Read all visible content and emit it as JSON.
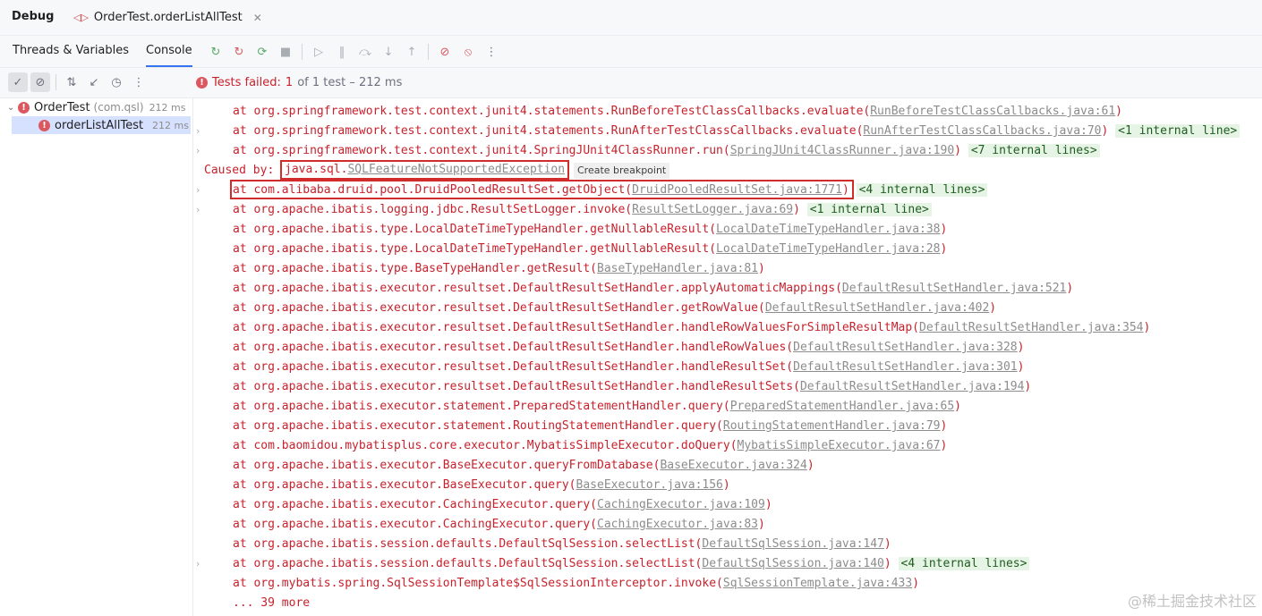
{
  "window": {
    "title": "Debug",
    "tab_label": "OrderTest.orderListAllTest"
  },
  "toolbar": {
    "tabs": [
      "Threads & Variables",
      "Console"
    ]
  },
  "status": {
    "failed_label": "Tests failed:",
    "failed_count": "1",
    "of_text": "of 1 test – 212 ms"
  },
  "tree": {
    "root": {
      "label": "OrderTest",
      "package": "(com.qsl)",
      "duration": "212 ms"
    },
    "child": {
      "label": "orderListAllTest",
      "duration": "212 ms"
    }
  },
  "console": {
    "caused_by": {
      "prefix": "Caused by:",
      "exception_pkg": "java.sql.",
      "exception_cls": "SQLFeatureNotSupportedException",
      "hint": "Create breakpoint"
    },
    "more": "... 39 more",
    "lines": [
      {
        "t": "at org.springframework.test.context.junit4.statements.RunBeforeTestClassCallbacks.evaluate(",
        "l": "RunBeforeTestClassCallbacks.java:61",
        "e": ")",
        "i": "",
        "fold": false
      },
      {
        "t": "at org.springframework.test.context.junit4.statements.RunAfterTestClassCallbacks.evaluate(",
        "l": "RunAfterTestClassCallbacks.java:70",
        "e": ")",
        "i": "<1 internal line>",
        "fold": true
      },
      {
        "t": "at org.springframework.test.context.junit4.SpringJUnit4ClassRunner.run(",
        "l": "SpringJUnit4ClassRunner.java:190",
        "e": ")",
        "i": "<7 internal lines>",
        "fold": true
      },
      {
        "t": "at com.alibaba.druid.pool.DruidPooledResultSet.getObject(",
        "l": "DruidPooledResultSet.java:1771",
        "e": ")",
        "i": "<4 internal lines>",
        "fold": true
      },
      {
        "t": "at org.apache.ibatis.logging.jdbc.ResultSetLogger.invoke(",
        "l": "ResultSetLogger.java:69",
        "e": ")",
        "i": "<1 internal line>",
        "fold": true
      },
      {
        "t": "at org.apache.ibatis.type.LocalDateTimeTypeHandler.getNullableResult(",
        "l": "LocalDateTimeTypeHandler.java:38",
        "e": ")",
        "i": "",
        "fold": false
      },
      {
        "t": "at org.apache.ibatis.type.LocalDateTimeTypeHandler.getNullableResult(",
        "l": "LocalDateTimeTypeHandler.java:28",
        "e": ")",
        "i": "",
        "fold": false
      },
      {
        "t": "at org.apache.ibatis.type.BaseTypeHandler.getResult(",
        "l": "BaseTypeHandler.java:81",
        "e": ")",
        "i": "",
        "fold": false
      },
      {
        "t": "at org.apache.ibatis.executor.resultset.DefaultResultSetHandler.applyAutomaticMappings(",
        "l": "DefaultResultSetHandler.java:521",
        "e": ")",
        "i": "",
        "fold": false
      },
      {
        "t": "at org.apache.ibatis.executor.resultset.DefaultResultSetHandler.getRowValue(",
        "l": "DefaultResultSetHandler.java:402",
        "e": ")",
        "i": "",
        "fold": false
      },
      {
        "t": "at org.apache.ibatis.executor.resultset.DefaultResultSetHandler.handleRowValuesForSimpleResultMap(",
        "l": "DefaultResultSetHandler.java:354",
        "e": ")",
        "i": "",
        "fold": false
      },
      {
        "t": "at org.apache.ibatis.executor.resultset.DefaultResultSetHandler.handleRowValues(",
        "l": "DefaultResultSetHandler.java:328",
        "e": ")",
        "i": "",
        "fold": false
      },
      {
        "t": "at org.apache.ibatis.executor.resultset.DefaultResultSetHandler.handleResultSet(",
        "l": "DefaultResultSetHandler.java:301",
        "e": ")",
        "i": "",
        "fold": false
      },
      {
        "t": "at org.apache.ibatis.executor.resultset.DefaultResultSetHandler.handleResultSets(",
        "l": "DefaultResultSetHandler.java:194",
        "e": ")",
        "i": "",
        "fold": false
      },
      {
        "t": "at org.apache.ibatis.executor.statement.PreparedStatementHandler.query(",
        "l": "PreparedStatementHandler.java:65",
        "e": ")",
        "i": "",
        "fold": false
      },
      {
        "t": "at org.apache.ibatis.executor.statement.RoutingStatementHandler.query(",
        "l": "RoutingStatementHandler.java:79",
        "e": ")",
        "i": "",
        "fold": false
      },
      {
        "t": "at com.baomidou.mybatisplus.core.executor.MybatisSimpleExecutor.doQuery(",
        "l": "MybatisSimpleExecutor.java:67",
        "e": ")",
        "i": "",
        "fold": false
      },
      {
        "t": "at org.apache.ibatis.executor.BaseExecutor.queryFromDatabase(",
        "l": "BaseExecutor.java:324",
        "e": ")",
        "i": "",
        "fold": false
      },
      {
        "t": "at org.apache.ibatis.executor.BaseExecutor.query(",
        "l": "BaseExecutor.java:156",
        "e": ")",
        "i": "",
        "fold": false
      },
      {
        "t": "at org.apache.ibatis.executor.CachingExecutor.query(",
        "l": "CachingExecutor.java:109",
        "e": ")",
        "i": "",
        "fold": false
      },
      {
        "t": "at org.apache.ibatis.executor.CachingExecutor.query(",
        "l": "CachingExecutor.java:83",
        "e": ")",
        "i": "",
        "fold": false
      },
      {
        "t": "at org.apache.ibatis.session.defaults.DefaultSqlSession.selectList(",
        "l": "DefaultSqlSession.java:147",
        "e": ")",
        "i": "",
        "fold": false
      },
      {
        "t": "at org.apache.ibatis.session.defaults.DefaultSqlSession.selectList(",
        "l": "DefaultSqlSession.java:140",
        "e": ")",
        "i": "<4 internal lines>",
        "fold": true
      },
      {
        "t": "at org.mybatis.spring.SqlSessionTemplate$SqlSessionInterceptor.invoke(",
        "l": "SqlSessionTemplate.java:433",
        "e": ")",
        "i": "",
        "fold": false
      }
    ]
  },
  "watermark": "@稀土掘金技术社区"
}
